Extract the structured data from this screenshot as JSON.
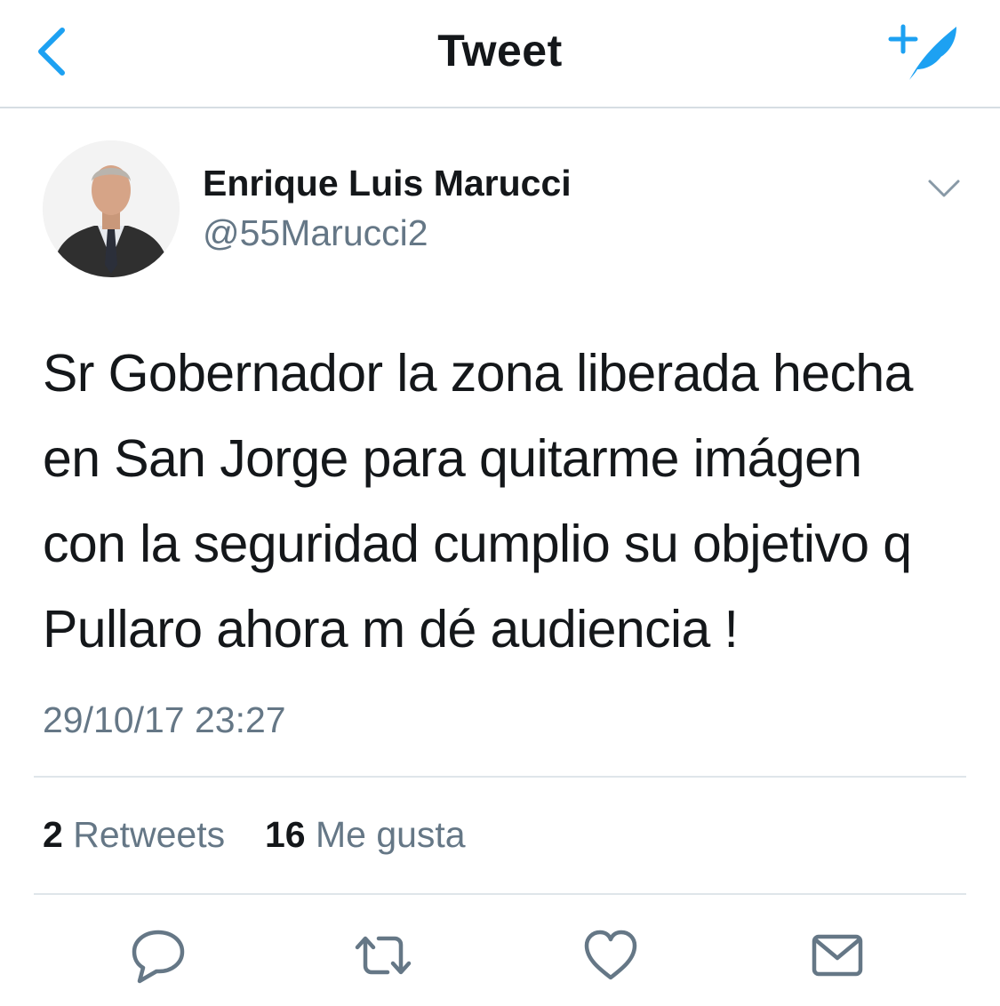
{
  "nav": {
    "title": "Tweet",
    "back_icon": "chevron-left-icon",
    "compose_icon": "compose-tweet-icon"
  },
  "tweet": {
    "author": {
      "name": "Enrique Luis Marucci",
      "handle": "@55Marucci2"
    },
    "text_lines": [
      "Sr Gobernador la zona liberada hecha",
      "en San Jorge para quitarme imágen",
      "con la seguridad cumplio su objetivo q",
      "Pullaro ahora m dé audiencia !"
    ],
    "timestamp": "29/10/17 23:27",
    "retweets": {
      "count": "2",
      "label": "Retweets"
    },
    "likes": {
      "count": "16",
      "label": "Me gusta"
    }
  },
  "actions": [
    "reply-icon",
    "retweet-icon",
    "like-icon",
    "share-icon"
  ],
  "colors": {
    "accent": "#1da1f2",
    "text": "#14171a",
    "secondary": "#657786",
    "divider": "#dfe5ea"
  }
}
